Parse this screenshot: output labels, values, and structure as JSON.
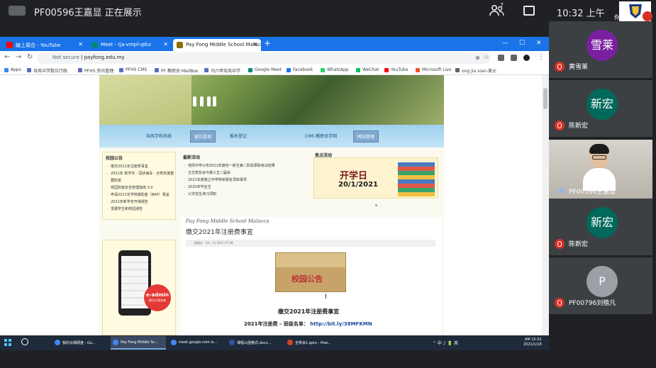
{
  "meeting": {
    "presenter_status": "PF00596王嘉显 正在展示",
    "people_count": "7",
    "clock": "10:32 上午",
    "self_label": "你"
  },
  "browser": {
    "tabs": [
      {
        "label": "線上周合 - YouTube",
        "fav_color": "#ff0000"
      },
      {
        "label": "Meet - tja-vmpf-qtkx",
        "fav_color": "#00897b"
      },
      {
        "label": "Pay Fong Middle School Malacca",
        "fav_color": "#8d6e00"
      }
    ],
    "new_tab": "+",
    "window_controls": [
      "—",
      "☐",
      "✕"
    ],
    "security": "Not secure",
    "url": "payfong.edu.my",
    "bookmarks": [
      {
        "label": "Apps",
        "color": "#4285f4"
      },
      {
        "label": "培风中学数位行政",
        "color": "#5c6bc0"
      },
      {
        "label": "PFHS 资讯管理",
        "color": "#5c6bc0"
      },
      {
        "label": "PFHS CMS",
        "color": "#5c6bc0"
      },
      {
        "label": "PF 教职员 MailBox",
        "color": "#5c6bc0"
      },
      {
        "label": "马六甲培风中学",
        "color": "#5c6bc0"
      },
      {
        "label": "Google Meet",
        "color": "#00897b"
      },
      {
        "label": "Facebook",
        "color": "#1877f2"
      },
      {
        "label": "WhatsApp",
        "color": "#25d366"
      },
      {
        "label": "WeChat",
        "color": "#07c160"
      },
      {
        "label": "YouTube",
        "color": "#ff0000"
      },
      {
        "label": "Microsoft Live",
        "color": "#f25022"
      },
      {
        "label": "ong jia xian-美元",
        "color": "#5f6368"
      }
    ]
  },
  "site": {
    "nav": [
      "培风学校系统",
      "留位查询",
      "报名登记",
      "CMS 教职员学网",
      "网站管理"
    ],
    "announcements_title": "校园公告",
    "announcements": [
      "缴交2021年注册费事宜",
      "2021年 新学年 - 冠状病毒 - 全校实施重要防疫",
      "校园防疫安全管理指南 3.0",
      "申请2021年学校援助金（BAP）事宜",
      "2021年新学年开课通告",
      "发展学生和校园通告"
    ],
    "latest_title": "最新活动",
    "latest": [
      "培风中学公布2021年度初一新生第二阶段录取考试结果",
      "五位校友会与第三五二届会",
      "2021年度独立中学统考报名须知事项",
      "2020年毕业生",
      "火灾逃生演习须知"
    ],
    "focus_title": "焦点活动",
    "focus_banner_title": "开学日",
    "focus_banner_date": "20/1/2021",
    "eadmin_line1": "e-admin",
    "eadmin_line2": "数位行政系统",
    "article_school": "Pay Fong Middle School Malacca",
    "article_title": "缴交2021年注册费事宜",
    "article_meta": "星期五 · 18 一月 2021 07:28",
    "envelope_text": "校园公告",
    "article_heading": "缴交2021年注册费事宜",
    "article_link_label": "2021年注册费 – 班级名单：",
    "article_link_url": "http://bit.ly/38MFKMN"
  },
  "taskbar": {
    "tasks": [
      {
        "label": "我的云端硬盘 - Go...",
        "color": "#4285f4"
      },
      {
        "label": "Pay Fong Middle Sc...",
        "color": "#4285f4"
      },
      {
        "label": "meet.google.com is...",
        "color": "#4285f4"
      },
      {
        "label": "课程公函格式.docx...",
        "color": "#2b579a"
      },
      {
        "label": "全校会1.pptx - Pow...",
        "color": "#d24726"
      }
    ],
    "tray": "⌃ 中 ♪ 🔋 英",
    "clock_time": "AM 10:32",
    "clock_date": "2021/1/18"
  },
  "participants": [
    {
      "avatar": "雪莱",
      "name": "黄雪莱",
      "avatar_color": "#7b1fa2"
    },
    {
      "avatar": "新宏",
      "name": "陈新宏",
      "avatar_color": "#00695c"
    },
    {
      "avatar": "",
      "name": "PF00596王嘉显",
      "video": true
    },
    {
      "avatar": "新宏",
      "name": "陈新宏",
      "avatar_color": "#00695c"
    },
    {
      "avatar": "P",
      "name": "PF00796刘楷凡",
      "avatar_color": "#9aa0a6"
    }
  ]
}
